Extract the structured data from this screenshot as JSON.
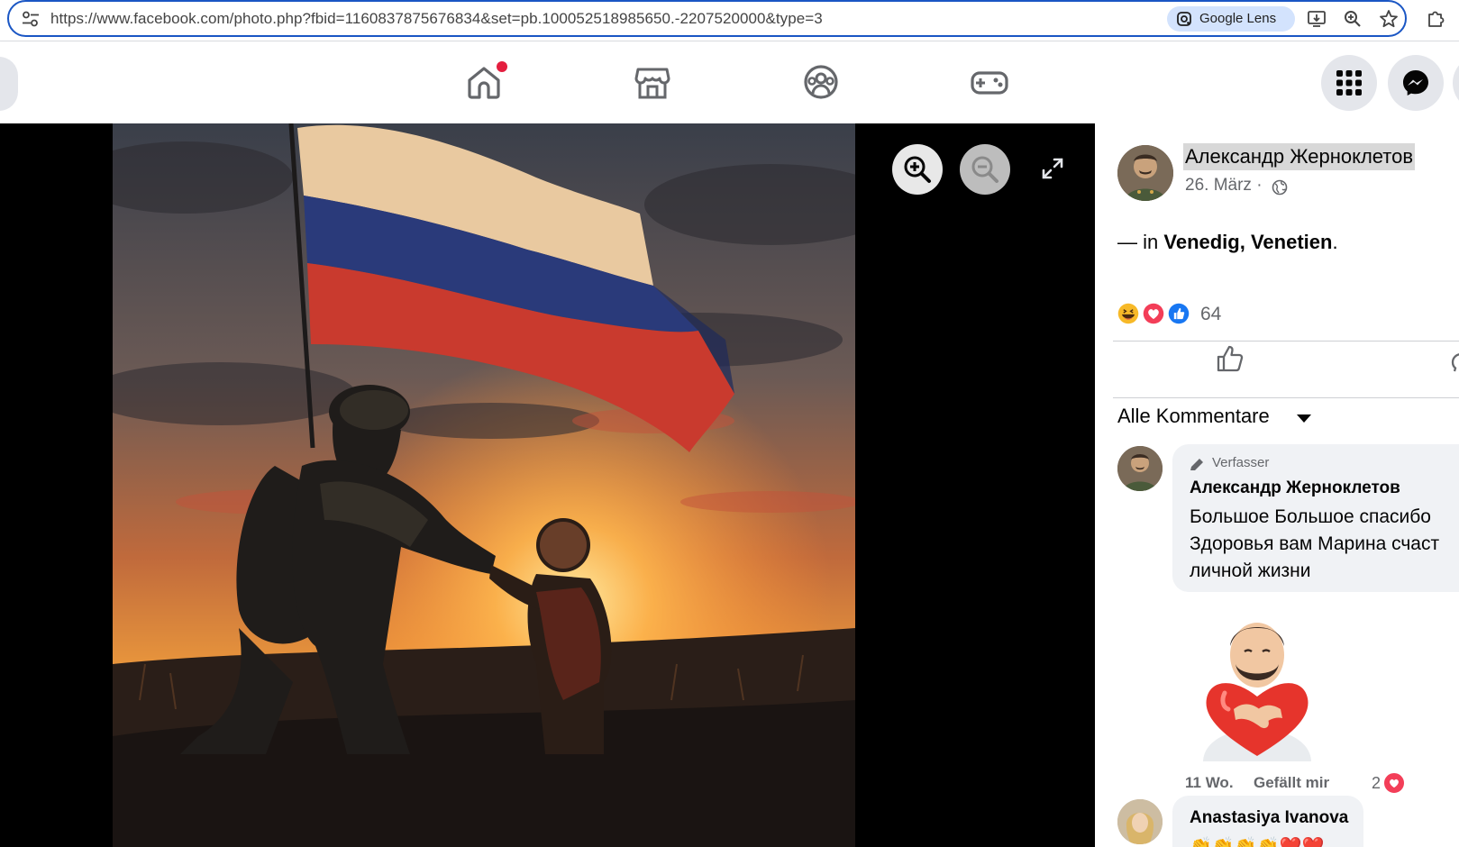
{
  "browser": {
    "url": "https://www.facebook.com/photo.php?fbid=1160837875676834&set=pb.100052518985650.-2207520000&type=3",
    "lens_label": "Google Lens"
  },
  "nav": {
    "tabs": [
      "home-icon",
      "marketplace-icon",
      "groups-icon",
      "gaming-icon"
    ],
    "right_buttons": [
      "menu-grid-icon",
      "messenger-icon"
    ]
  },
  "viewer": {
    "zoom_in": "zoom-in-icon",
    "zoom_out": "zoom-out-icon",
    "fullscreen": "fullscreen-icon"
  },
  "post": {
    "author": "Александр Жерноклетов",
    "date": "26. März ·",
    "location_prefix": "— in",
    "location": "Venedig, Venetien",
    "location_suffix": ".",
    "reaction_count": "64",
    "all_comments_label": "Alle Kommentare"
  },
  "comments": [
    {
      "badge": "Verfasser",
      "name": "Александр Жерноклетов",
      "text": "Большое Большое спасибо\nЗдоровья вам Марина счаст\nличной жизни",
      "time": "11 Wo.",
      "like_label": "Gefällt mir",
      "reaction_count": "2"
    },
    {
      "name": "Anastasiya Ivanova",
      "text": "👏👏👏👏❤️❤️"
    }
  ],
  "colors": {
    "accent": "#1877f2",
    "url_border": "#1a56c4",
    "like_blue": "#1877f2",
    "love_red": "#f33e58",
    "haha_yellow": "#f7b928"
  }
}
